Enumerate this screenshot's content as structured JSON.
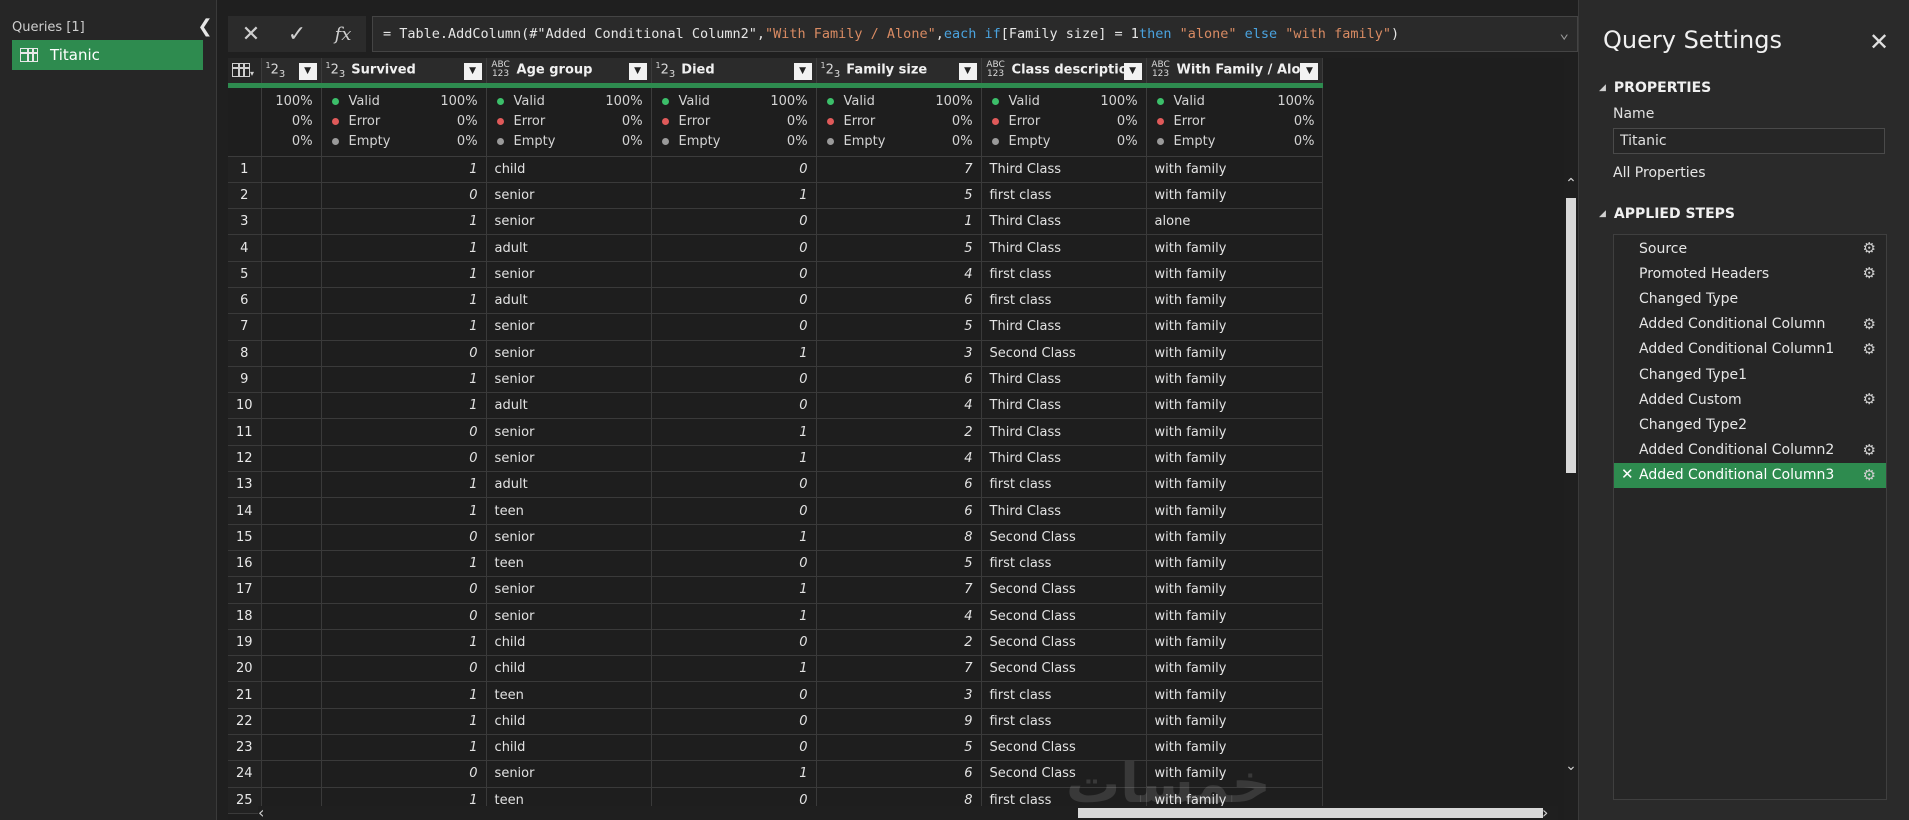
{
  "queries": {
    "header": "Queries [1]",
    "items": [
      {
        "label": "Titanic"
      }
    ]
  },
  "formula": {
    "prefix": "= Table.AddColumn(#\"Added Conditional Column2\", ",
    "col_str": "\"With Family / Alone\"",
    "mid1": ", ",
    "kw_each": "each",
    "kw_if": "if",
    "cond": " [Family size] = 1 ",
    "kw_then": "then",
    "str_alone": "\"alone\"",
    "kw_else": "else",
    "str_family": "\"with family\"",
    "suffix": ")"
  },
  "grid": {
    "columns": [
      {
        "name": "",
        "type": "123"
      },
      {
        "name": "Survived",
        "type": "123"
      },
      {
        "name": "Age group",
        "type": "ABC123"
      },
      {
        "name": "Died",
        "type": "123"
      },
      {
        "name": "Family size",
        "type": "123"
      },
      {
        "name": "Class description",
        "type": "ABC123"
      },
      {
        "name": "With Family / Alone",
        "type": "ABC123"
      }
    ],
    "quality": {
      "valid_label": "Valid",
      "error_label": "Error",
      "empty_label": "Empty",
      "first_col": [
        "100%",
        "0%",
        "0%"
      ],
      "valid_pct": "100%",
      "error_pct": "0%",
      "empty_pct": "0%"
    },
    "rows": [
      [
        "1",
        "1",
        "child",
        "0",
        "7",
        "Third Class",
        "with family"
      ],
      [
        "2",
        "0",
        "senior",
        "1",
        "5",
        "first class",
        "with family"
      ],
      [
        "3",
        "1",
        "senior",
        "0",
        "1",
        "Third Class",
        "alone"
      ],
      [
        "4",
        "1",
        "adult",
        "0",
        "5",
        "Third Class",
        "with family"
      ],
      [
        "5",
        "1",
        "senior",
        "0",
        "4",
        "first class",
        "with family"
      ],
      [
        "6",
        "1",
        "adult",
        "0",
        "6",
        "first class",
        "with family"
      ],
      [
        "7",
        "1",
        "senior",
        "0",
        "5",
        "Third Class",
        "with family"
      ],
      [
        "8",
        "0",
        "senior",
        "1",
        "3",
        "Second Class",
        "with family"
      ],
      [
        "9",
        "1",
        "senior",
        "0",
        "6",
        "Third Class",
        "with family"
      ],
      [
        "10",
        "1",
        "adult",
        "0",
        "4",
        "Third Class",
        "with family"
      ],
      [
        "11",
        "0",
        "senior",
        "1",
        "2",
        "Third Class",
        "with family"
      ],
      [
        "12",
        "0",
        "senior",
        "1",
        "4",
        "Third Class",
        "with family"
      ],
      [
        "13",
        "1",
        "adult",
        "0",
        "6",
        "first class",
        "with family"
      ],
      [
        "14",
        "1",
        "teen",
        "0",
        "6",
        "Third Class",
        "with family"
      ],
      [
        "15",
        "0",
        "senior",
        "1",
        "8",
        "Second Class",
        "with family"
      ],
      [
        "16",
        "1",
        "teen",
        "0",
        "5",
        "first class",
        "with family"
      ],
      [
        "17",
        "0",
        "senior",
        "1",
        "7",
        "Second Class",
        "with family"
      ],
      [
        "18",
        "0",
        "senior",
        "1",
        "4",
        "Second Class",
        "with family"
      ],
      [
        "19",
        "1",
        "child",
        "0",
        "2",
        "Second Class",
        "with family"
      ],
      [
        "20",
        "0",
        "child",
        "1",
        "7",
        "Second Class",
        "with family"
      ],
      [
        "21",
        "1",
        "teen",
        "0",
        "3",
        "first class",
        "with family"
      ],
      [
        "22",
        "1",
        "child",
        "0",
        "9",
        "first class",
        "with family"
      ],
      [
        "23",
        "1",
        "child",
        "0",
        "5",
        "Second Class",
        "with family"
      ],
      [
        "24",
        "0",
        "senior",
        "1",
        "6",
        "Second Class",
        "with family"
      ],
      [
        "25",
        "1",
        "teen",
        "0",
        "8",
        "first class",
        "with family"
      ]
    ]
  },
  "settings": {
    "title": "Query Settings",
    "properties_title": "PROPERTIES",
    "name_label": "Name",
    "name_value": "Titanic",
    "all_properties": "All Properties",
    "applied_steps_title": "APPLIED STEPS",
    "steps": [
      {
        "label": "Source",
        "gear": true,
        "active": false
      },
      {
        "label": "Promoted Headers",
        "gear": true,
        "active": false
      },
      {
        "label": "Changed Type",
        "gear": false,
        "active": false
      },
      {
        "label": "Added Conditional Column",
        "gear": true,
        "active": false
      },
      {
        "label": "Added Conditional Column1",
        "gear": true,
        "active": false
      },
      {
        "label": "Changed Type1",
        "gear": false,
        "active": false
      },
      {
        "label": "Added Custom",
        "gear": true,
        "active": false
      },
      {
        "label": "Changed Type2",
        "gear": false,
        "active": false
      },
      {
        "label": "Added Conditional Column2",
        "gear": true,
        "active": false
      },
      {
        "label": "Added Conditional Column3",
        "gear": true,
        "active": true
      }
    ]
  },
  "watermark": "خمسات",
  "colors": {
    "accent": "#2e8b4f",
    "valid": "#3cbf6a",
    "error": "#e05a5a",
    "empty": "#9a9a9a"
  }
}
